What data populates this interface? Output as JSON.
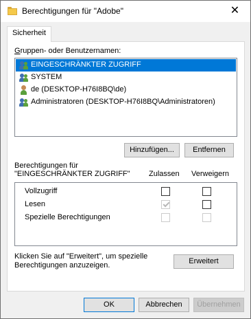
{
  "window": {
    "title": "Berechtigungen für \"Adobe\"",
    "close_glyph": "✕"
  },
  "tabs": [
    {
      "label": "Sicherheit"
    }
  ],
  "users": {
    "label": "Gruppen- oder Benutzernamen:",
    "items": [
      {
        "name": "EINGESCHRÄNKTER ZUGRIFF",
        "icon": "group-icon",
        "selected": true
      },
      {
        "name": "SYSTEM",
        "icon": "group-icon",
        "selected": false
      },
      {
        "name": "de (DESKTOP-H76I8BQ\\de)",
        "icon": "user-icon",
        "selected": false
      },
      {
        "name": "Administratoren (DESKTOP-H76I8BQ\\Administratoren)",
        "icon": "group-icon",
        "selected": false
      }
    ],
    "add_button": "Hinzufügen...",
    "remove_button": "Entfernen"
  },
  "permissions": {
    "label_line1": "Berechtigungen für",
    "label_line2": "\"EINGESCHRÄNKTER ZUGRIFF\"",
    "col_allow": "Zulassen",
    "col_deny": "Verweigern",
    "rows": [
      {
        "name": "Vollzugriff",
        "allow": false,
        "deny": false,
        "disabled": false
      },
      {
        "name": "Lesen",
        "allow": true,
        "deny": false,
        "disabled": false,
        "allow_disabled": true
      },
      {
        "name": "Spezielle Berechtigungen",
        "allow": false,
        "deny": false,
        "disabled": true
      }
    ]
  },
  "advanced": {
    "hint": "Klicken Sie auf \"Erweitert\", um spezielle Berechtigungen anzuzeigen.",
    "button": "Erweitert"
  },
  "footer": {
    "ok": "OK",
    "cancel": "Abbrechen",
    "apply": "Übernehmen"
  },
  "colors": {
    "selection": "#0078d7",
    "group_icon_a": "#3f6fb0",
    "group_icon_b": "#5aa03c"
  }
}
